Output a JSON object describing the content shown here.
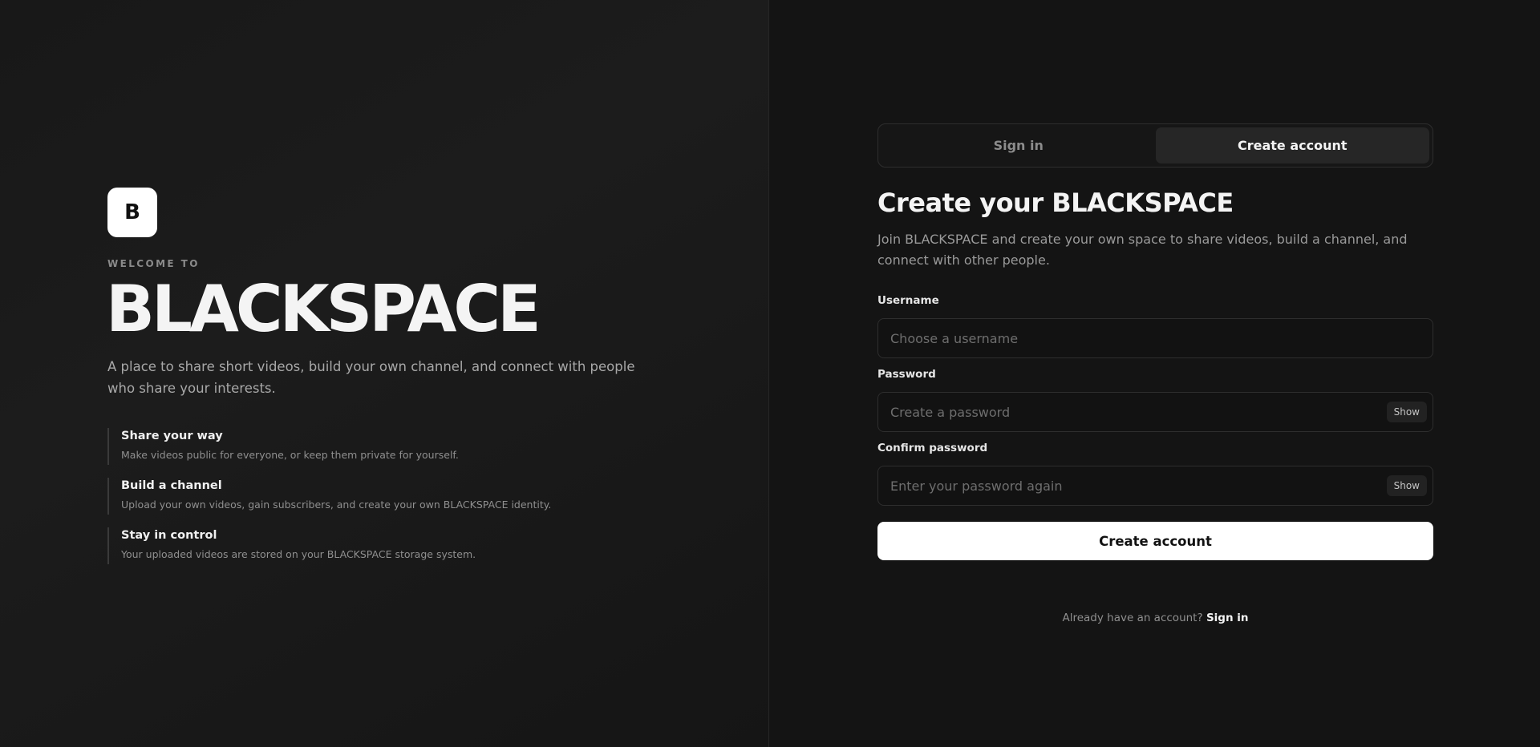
{
  "brand": {
    "logo_letter": "B",
    "welcome": "WELCOME TO",
    "name": "BLACKSPACE",
    "tagline": "A place to share short videos, build your own channel, and connect with people who share your interests."
  },
  "features": [
    {
      "title": "Share your way",
      "description": "Make videos public for everyone, or keep them private for yourself."
    },
    {
      "title": "Build a channel",
      "description": "Upload your own videos, gain subscribers, and create your own BLACKSPACE identity."
    },
    {
      "title": "Stay in control",
      "description": "Your uploaded videos are stored on your BLACKSPACE storage system."
    }
  ],
  "tabs": [
    {
      "label": "Sign in",
      "active": false
    },
    {
      "label": "Create account",
      "active": true
    }
  ],
  "form": {
    "title": "Create your BLACKSPACE",
    "subtitle": "Join BLACKSPACE and create your own space to share videos, build a channel, and connect with other people.",
    "username": {
      "label": "Username",
      "placeholder": "Choose a username",
      "value": ""
    },
    "password": {
      "label": "Password",
      "placeholder": "Create a password",
      "value": "",
      "toggle": "Show"
    },
    "confirm": {
      "label": "Confirm password",
      "placeholder": "Enter your password again",
      "value": "",
      "toggle": "Show"
    },
    "submit_label": "Create account"
  },
  "footer": {
    "prompt": "Already have an account?",
    "link": "Sign in"
  },
  "colors": {
    "background": "#141414",
    "accent": "#ffffff",
    "muted_text": "#9a9a9a"
  }
}
